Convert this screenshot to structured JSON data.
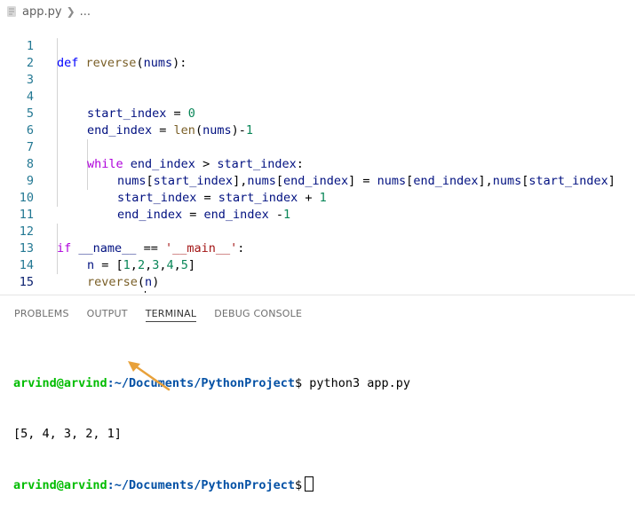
{
  "breadcrumb": {
    "file": "app.py",
    "rest": "..."
  },
  "code": {
    "lines": [
      {
        "n": "1",
        "text": "def reverse(nums):"
      },
      {
        "n": "2",
        "text": ""
      },
      {
        "n": "3",
        "text": ""
      },
      {
        "n": "4",
        "text": "start_index = 0"
      },
      {
        "n": "5",
        "text": "end_index = len(nums)-1"
      },
      {
        "n": "6",
        "text": ""
      },
      {
        "n": "7",
        "text": "while end_index > start_index:"
      },
      {
        "n": "8",
        "text": "nums[start_index],nums[end_index] = nums[end_index],nums[start_index]"
      },
      {
        "n": "9",
        "text": "start_index = start_index + 1"
      },
      {
        "n": "10",
        "text": "end_index = end_index -1"
      },
      {
        "n": "11",
        "text": ""
      },
      {
        "n": "12",
        "text": "if __name__ == '__main__':"
      },
      {
        "n": "13",
        "text": "n = [1,2,3,4,5]"
      },
      {
        "n": "14",
        "text": "reverse(n)"
      },
      {
        "n": "15",
        "text": "print(n)"
      }
    ],
    "active_line": "15"
  },
  "panel": {
    "tabs": [
      "PROBLEMS",
      "OUTPUT",
      "TERMINAL",
      "DEBUG CONSOLE"
    ],
    "active_tab": "TERMINAL"
  },
  "terminal": {
    "user": "arvind@arvind",
    "path": ":~/Documents/PythonProject",
    "prompt_symbol": "$",
    "command": " python3 app.py",
    "output": "[5, 4, 3, 2, 1]"
  },
  "colors": {
    "keyword": "#0000ff",
    "control": "#af00db",
    "function": "#795e26",
    "number": "#098658",
    "string": "#a31515",
    "line_number": "#237893",
    "terminal_user": "#00bc00",
    "terminal_path": "#0451a5",
    "annotation_arrow": "#e8a13a"
  },
  "icons": {
    "file": "python-file-icon",
    "separator": "chevron-right-icon",
    "annotation": "arrow-annotation-icon"
  }
}
